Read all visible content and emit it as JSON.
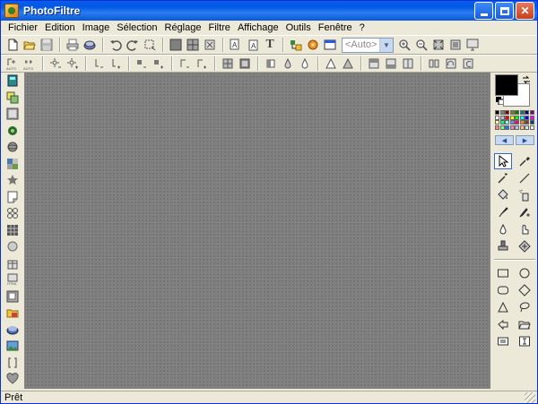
{
  "window": {
    "title": "PhotoFiltre",
    "minimize_icon": "minimize-icon",
    "maximize_icon": "maximize-icon",
    "close_label": "✕"
  },
  "menu": {
    "items": [
      {
        "id": "fichier",
        "label": "Fichier"
      },
      {
        "id": "edition",
        "label": "Edition"
      },
      {
        "id": "image",
        "label": "Image"
      },
      {
        "id": "selection",
        "label": "Sélection"
      },
      {
        "id": "reglage",
        "label": "Réglage"
      },
      {
        "id": "filtre",
        "label": "Filtre"
      },
      {
        "id": "affichage",
        "label": "Affichage"
      },
      {
        "id": "outils",
        "label": "Outils"
      },
      {
        "id": "fenetre",
        "label": "Fenêtre"
      },
      {
        "id": "help",
        "label": "?"
      }
    ]
  },
  "toolbar": {
    "zoom_combo_value": "<Auto>",
    "text_tool_label": "T"
  },
  "colors": {
    "foreground": "#000000",
    "background": "#ffffff",
    "palette": [
      "#000000",
      "#808080",
      "#800000",
      "#808000",
      "#008000",
      "#008080",
      "#000080",
      "#800080",
      "#ffffff",
      "#c0c0c0",
      "#ff0000",
      "#ffff00",
      "#00ff00",
      "#00ffff",
      "#0000ff",
      "#ff00ff",
      "#ffff80",
      "#00ff80",
      "#80ffff",
      "#8080ff",
      "#ff0080",
      "#ff8040",
      "#804000",
      "#004080",
      "#ff8080",
      "#80ff80",
      "#0080ff",
      "#ff80c0",
      "#c0c0ff",
      "#ffc080",
      "#e0e0e0",
      "#f0f0f0"
    ]
  },
  "status": {
    "text": "Prêt"
  }
}
